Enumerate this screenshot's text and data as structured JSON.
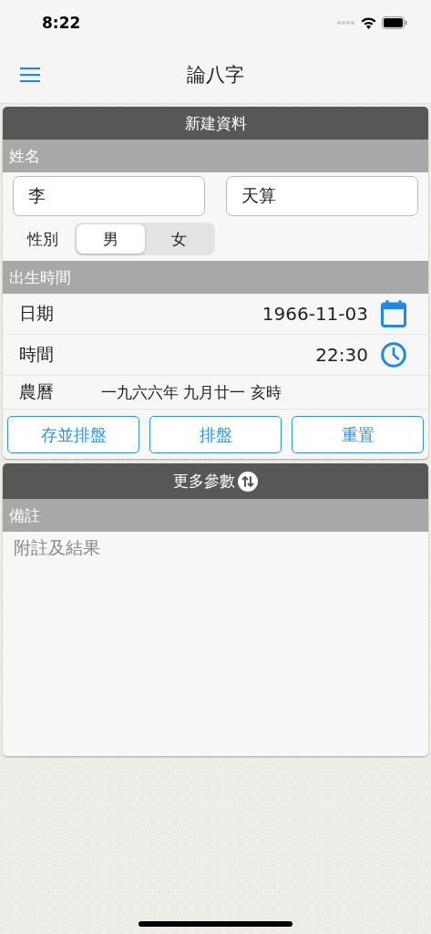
{
  "status_bar": {
    "time": "8:22"
  },
  "nav": {
    "title": "論八字"
  },
  "new_record": {
    "title": "新建資料",
    "name_section": "姓名",
    "surname": {
      "value": "李"
    },
    "given_name": {
      "value": "天算"
    },
    "gender": {
      "label": "性別",
      "options": [
        {
          "label": "男",
          "selected": true
        },
        {
          "label": "女",
          "selected": false
        }
      ]
    },
    "birth_section": "出生時間",
    "rows": [
      {
        "kind": "date",
        "label": "日期",
        "value": "1966-11-03"
      },
      {
        "kind": "time",
        "label": "時間",
        "value": "22:30"
      },
      {
        "kind": "lunar",
        "label": "農曆",
        "value": "一九六六年 九月廿一 亥時"
      }
    ],
    "buttons": [
      "存並排盤",
      "排盤",
      "重置"
    ]
  },
  "more": {
    "title": "更多參數"
  },
  "notes": {
    "section": "備註",
    "placeholder": "附註及結果"
  }
}
